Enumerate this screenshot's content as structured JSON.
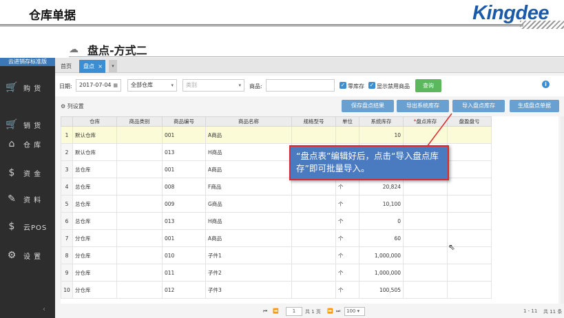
{
  "slide": {
    "title": "仓库单据",
    "logo": "Kingdee",
    "subtitle": "盘点-方式二"
  },
  "sidebar": {
    "edition": "云进销存标准版",
    "items": [
      {
        "icon": "cart-icon",
        "glyph": "🛒",
        "label": "购 货"
      },
      {
        "icon": "sales-cart-icon",
        "glyph": "🛒",
        "label": "销 货"
      },
      {
        "icon": "warehouse-icon",
        "glyph": "⌂",
        "label": "仓 库"
      },
      {
        "icon": "money-icon",
        "glyph": "$",
        "label": "资 金"
      },
      {
        "icon": "pencil-icon",
        "glyph": "✎",
        "label": "资 料"
      },
      {
        "icon": "pos-icon",
        "glyph": "$",
        "label": "云POS"
      },
      {
        "icon": "gear-icon",
        "glyph": "⚙",
        "label": "设 置"
      }
    ]
  },
  "tabs": {
    "home": "首页",
    "active": "盘点",
    "close": "×",
    "more": "▾"
  },
  "filters": {
    "date_label": "日期:",
    "date_value": "2017-07-04",
    "warehouse_value": "全部仓库",
    "category_placeholder": "类别",
    "goods_label": "商品:",
    "goods_value": "",
    "zero_stock_label": "零库存",
    "show_disabled_label": "显示禁用商品",
    "query_label": "查询"
  },
  "toolbar": {
    "column_settings": "列设置",
    "save_label": "保存盘点结果",
    "export_label": "导出系统库存",
    "import_label": "导入盘点库存",
    "generate_label": "生成盘点单据"
  },
  "table": {
    "columns": [
      "",
      "仓库",
      "商品类别",
      "商品编号",
      "商品名称",
      "规格型号",
      "单位",
      "系统库存",
      "盘点库存",
      "盘盈盘亏"
    ],
    "required_mark": "*",
    "rows": [
      {
        "n": "1",
        "wh": "默认仓库",
        "cat": "",
        "code": "001",
        "name": "A商品",
        "spec": "",
        "unit": "",
        "stock": "10",
        "count": "",
        "diff": ""
      },
      {
        "n": "2",
        "wh": "默认仓库",
        "cat": "",
        "code": "013",
        "name": "H商品",
        "spec": "",
        "unit": "",
        "stock": "",
        "count": "",
        "diff": ""
      },
      {
        "n": "3",
        "wh": "总仓库",
        "cat": "",
        "code": "001",
        "name": "A商品",
        "spec": "",
        "unit": "",
        "stock": "",
        "count": "",
        "diff": ""
      },
      {
        "n": "4",
        "wh": "总仓库",
        "cat": "",
        "code": "008",
        "name": "F商品",
        "spec": "",
        "unit": "个",
        "stock": "20,824",
        "count": "",
        "diff": ""
      },
      {
        "n": "5",
        "wh": "总仓库",
        "cat": "",
        "code": "009",
        "name": "G商品",
        "spec": "",
        "unit": "个",
        "stock": "10,100",
        "count": "",
        "diff": ""
      },
      {
        "n": "6",
        "wh": "总仓库",
        "cat": "",
        "code": "013",
        "name": "H商品",
        "spec": "",
        "unit": "个",
        "stock": "0",
        "count": "",
        "diff": ""
      },
      {
        "n": "7",
        "wh": "分仓库",
        "cat": "",
        "code": "001",
        "name": "A商品",
        "spec": "",
        "unit": "个",
        "stock": "60",
        "count": "",
        "diff": ""
      },
      {
        "n": "8",
        "wh": "分仓库",
        "cat": "",
        "code": "010",
        "name": "子件1",
        "spec": "",
        "unit": "个",
        "stock": "1,000,000",
        "count": "",
        "diff": ""
      },
      {
        "n": "9",
        "wh": "分仓库",
        "cat": "",
        "code": "011",
        "name": "子件2",
        "spec": "",
        "unit": "个",
        "stock": "1,000,000",
        "count": "",
        "diff": ""
      },
      {
        "n": "10",
        "wh": "分仓库",
        "cat": "",
        "code": "012",
        "name": "子件3",
        "spec": "",
        "unit": "个",
        "stock": "100,505",
        "count": "",
        "diff": ""
      }
    ]
  },
  "pager": {
    "first": "⏮",
    "prev": "⏪",
    "page": "1",
    "total_pages": "共 1 页",
    "next": "⏩",
    "last": "⏭",
    "page_size": "100 ▾",
    "summary": "1 - 11",
    "total_records": "共 11 条"
  },
  "callout": {
    "text": "“盘点表”编辑好后，点击“导入盘点库存”即可批量导入。"
  },
  "colors": {
    "accent": "#3c8ed3",
    "sidebar": "#2d2d2d",
    "button": "#6aa0cf",
    "highlight": "#e0262a",
    "callout": "#4a7ac0",
    "query": "#5cb85c"
  }
}
